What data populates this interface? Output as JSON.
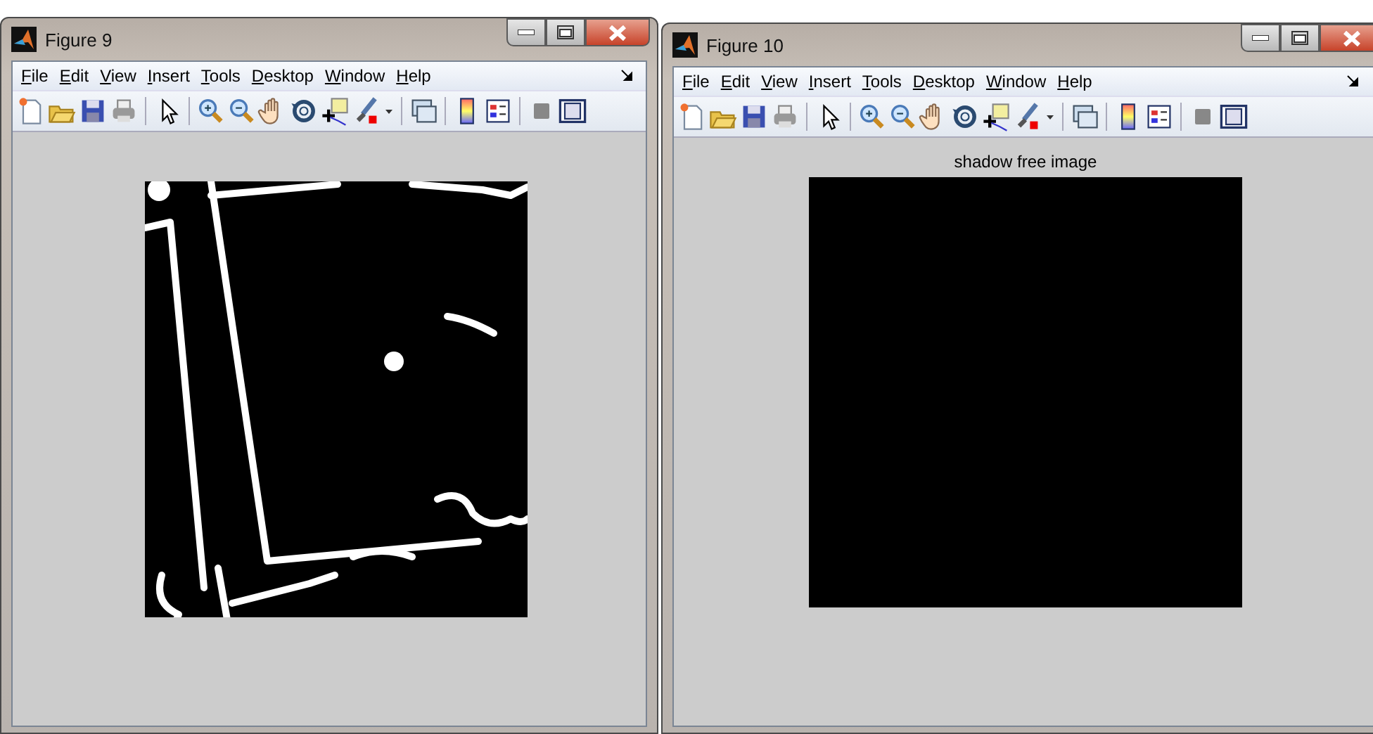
{
  "windows": [
    {
      "title": "Figure 9",
      "menu": [
        "File",
        "Edit",
        "View",
        "Insert",
        "Tools",
        "Desktop",
        "Window",
        "Help"
      ]
    },
    {
      "title": "Figure 10",
      "menu": [
        "File",
        "Edit",
        "View",
        "Insert",
        "Tools",
        "Desktop",
        "Window",
        "Help"
      ],
      "axes_title": "shadow free image",
      "image": {
        "kind": "blank"
      }
    }
  ]
}
